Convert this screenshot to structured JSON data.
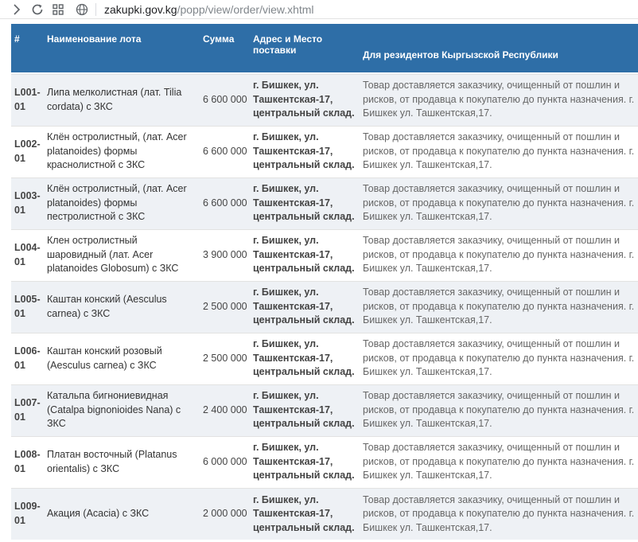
{
  "browser": {
    "url_host": "zakupki.gov.kg",
    "url_path": "/popp/view/order/view.xhtml"
  },
  "table": {
    "headers": {
      "num": "#",
      "name": "Наименование лота",
      "sum": "Сумма",
      "addr": "Адрес и Место поставки",
      "residents": "Для резидентов Кыргызской Республики"
    },
    "rows": [
      {
        "num": "L001-01",
        "name": "Липа мелколистная (лат. Tilia cordata) с ЗКС",
        "sum": "6 600 000",
        "addr": "г. Бишкек, ул. Ташкентская-17, центральный склад.",
        "residents": "Товар доставляется заказчику, очищенный от пошлин и рисков, от продавца к покупателю до пункта назначения. г. Бишкек ул. Ташкентская,17."
      },
      {
        "num": "L002-01",
        "name": "Клён остролистный, (лат. Acer platanoides) формы краснолистной с ЗКС",
        "sum": "6 600 000",
        "addr": "г. Бишкек, ул. Ташкентская-17, центральный склад.",
        "residents": "Товар доставляется заказчику, очищенный от пошлин и рисков, от продавца к покупателю до пункта назначения. г. Бишкек ул. Ташкентская,17."
      },
      {
        "num": "L003-01",
        "name": "Клён остролистный, (лат. Acer platanoides) формы пестролистной с ЗКС",
        "sum": "6 600 000",
        "addr": "г. Бишкек, ул. Ташкентская-17, центральный склад.",
        "residents": "Товар доставляется заказчику, очищенный от пошлин и рисков, от продавца к покупателю до пункта назначения. г. Бишкек ул. Ташкентская,17."
      },
      {
        "num": "L004-01",
        "name": "Клен остролистный шаровидный (лат. Acer platanoides Globosum) с ЗКС",
        "sum": "3 900 000",
        "addr": "г. Бишкек, ул. Ташкентская-17, центральный склад.",
        "residents": "Товар доставляется заказчику, очищенный от пошлин и рисков, от продавца к покупателю до пункта назначения. г. Бишкек ул. Ташкентская,17."
      },
      {
        "num": "L005-01",
        "name": "Каштан конский (Aesculus carnea) с ЗКС",
        "sum": "2 500 000",
        "addr": "г. Бишкек, ул. Ташкентская-17, центральный склад.",
        "residents": "Товар доставляется заказчику, очищенный от пошлин и рисков, от продавца к покупателю до пункта назначения. г. Бишкек ул. Ташкентская,17."
      },
      {
        "num": "L006-01",
        "name": "Каштан конский розовый (Aesculus carnea) с ЗКС",
        "sum": "2 500 000",
        "addr": "г. Бишкек, ул. Ташкентская-17, центральный склад.",
        "residents": "Товар доставляется заказчику, очищенный от пошлин и рисков, от продавца к покупателю до пункта назначения. г. Бишкек ул. Ташкентская,17."
      },
      {
        "num": "L007-01",
        "name": "Катальпа бигнониевидная (Catalpa bignonioides Nana) с ЗКС",
        "sum": "2 400 000",
        "addr": "г. Бишкек, ул. Ташкентская-17, центральный склад.",
        "residents": "Товар доставляется заказчику, очищенный от пошлин и рисков, от продавца к покупателю до пункта назначения. г. Бишкек ул. Ташкентская,17."
      },
      {
        "num": "L008-01",
        "name": "Платан восточный (Platanus orientalis) с ЗКС",
        "sum": "6 000 000",
        "addr": "г. Бишкек, ул. Ташкентская-17, центральный склад.",
        "residents": "Товар доставляется заказчику, очищенный от пошлин и рисков, от продавца к покупателю до пункта назначения. г. Бишкек ул. Ташкентская,17."
      },
      {
        "num": "L009-01",
        "name": "Акация (Acacia) с ЗКС",
        "sum": "2 000 000",
        "addr": "г. Бишкек, ул. Ташкентская-17, центральный склад.",
        "residents": "Товар доставляется заказчику, очищенный от пошлин и рисков, от продавца к покупателю до пункта назначения. г. Бишкек ул. Ташкентская,17."
      }
    ]
  }
}
